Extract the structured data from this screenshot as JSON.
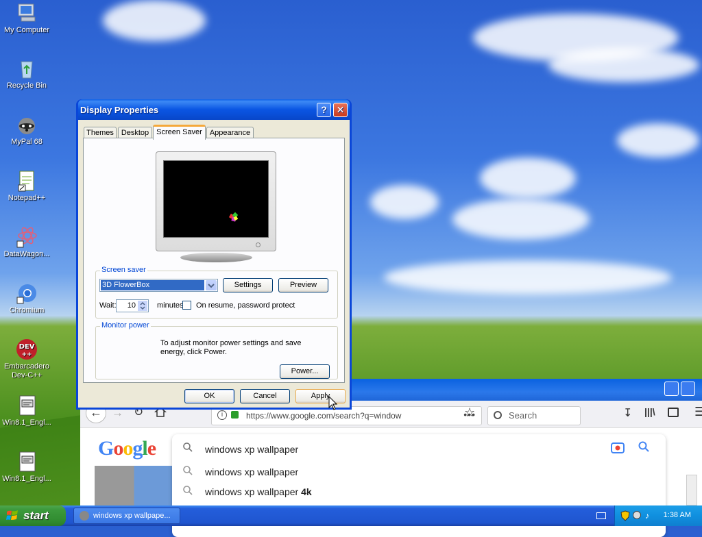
{
  "desktop": {
    "icons": [
      {
        "label": "My Computer",
        "icon": "computer-icon"
      },
      {
        "label": "Recycle Bin",
        "icon": "recycle-bin-icon"
      },
      {
        "label": "MyPal 68",
        "icon": "raccoon-browser-icon"
      },
      {
        "label": "Notepad++",
        "icon": "notepad-icon"
      },
      {
        "label": "DataWagon...",
        "icon": "atom-icon"
      },
      {
        "label": "Chromium",
        "icon": "chromium-icon"
      },
      {
        "label": "Embarcadero Dev-C++",
        "icon": "devcpp-icon"
      },
      {
        "label": "Win8.1_Engl...",
        "icon": "iso-file-icon"
      },
      {
        "label": "Win8.1_Engl...",
        "icon": "iso-file-icon"
      }
    ]
  },
  "dialog": {
    "title": "Display Properties",
    "tabs": [
      "Themes",
      "Desktop",
      "Screen Saver",
      "Appearance"
    ],
    "active_tab": "Screen Saver",
    "screen_saver": {
      "group_label": "Screen saver",
      "selected": "3D FlowerBox",
      "settings_label": "Settings",
      "preview_label": "Preview",
      "wait_label": "Wait:",
      "wait_value": "10",
      "minutes_label": "minutes",
      "password_label": "On resume, password protect"
    },
    "monitor_power": {
      "group_label": "Monitor power",
      "text": "To adjust monitor power settings and save energy, click Power.",
      "power_label": "Power..."
    },
    "buttons": {
      "ok": "OK",
      "cancel": "Cancel",
      "apply": "Apply"
    }
  },
  "browser": {
    "url": "https://www.google.com/search?q=window",
    "search_placeholder": "Search",
    "query": "windows xp wallpaper",
    "suggestions": [
      {
        "text": "windows xp wallpaper",
        "bold": ""
      },
      {
        "text": "windows xp wallpaper ",
        "bold": "4k"
      }
    ]
  },
  "taskbar": {
    "start_label": "start",
    "task_label": "windows xp wallpape...",
    "clock": "1:38 AM"
  },
  "colors": {
    "xp_blue": "#0a46d8",
    "taskbar_blue": "#245edb",
    "start_green": "#3c9a3c",
    "selection_blue": "#316ac5"
  }
}
